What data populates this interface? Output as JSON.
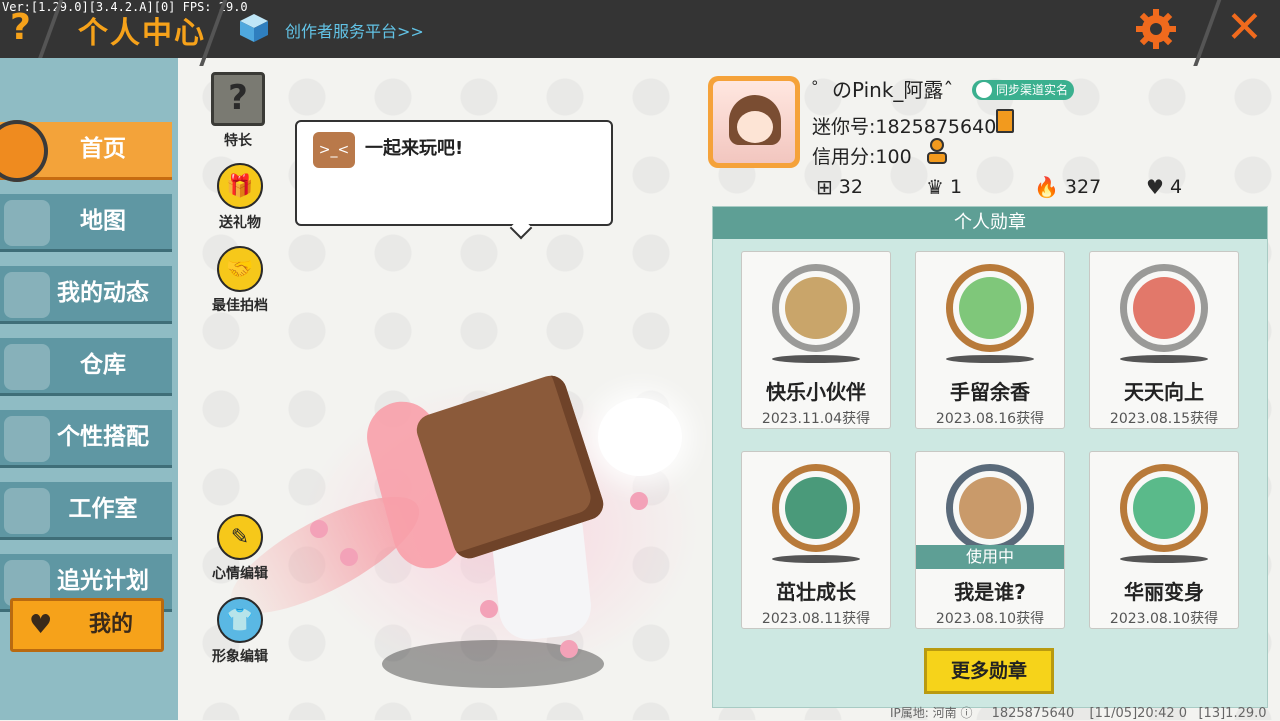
{
  "topbar": {
    "version_text": "Ver:[1.29.0][3.4.2.A][0] FPS: 29.0",
    "title": "个人中心",
    "creator_link": "创作者服务平台>>",
    "help_glyph": "?",
    "close_glyph": "✕"
  },
  "nav": {
    "items": [
      {
        "label": "首页",
        "icon": "home-icon",
        "active": true
      },
      {
        "label": "地图",
        "icon": "map-icon"
      },
      {
        "label": "我的动态",
        "icon": "bell-icon"
      },
      {
        "label": "仓库",
        "icon": "warehouse-icon"
      },
      {
        "label": "个性搭配",
        "icon": "outfit-icon"
      },
      {
        "label": "工作室",
        "icon": "studio-icon"
      },
      {
        "label": "追光计划",
        "icon": "light-plan-icon"
      }
    ],
    "my_button": "我的"
  },
  "actions": {
    "specialty": "特长",
    "gift": "送礼物",
    "best_partner": "最佳拍档",
    "mood_edit": "心情编辑",
    "avatar_edit": "形象编辑"
  },
  "bubble": {
    "text": "一起来玩吧!"
  },
  "profile": {
    "nickname": "゜のPink_阿露ˆ",
    "realname_tag": "同步渠道实名",
    "mini_id": "迷你号:1825875640",
    "credit": "信用分:100",
    "stats": {
      "likes": "32",
      "fans": "1",
      "popularity": "327",
      "hearts": "4"
    }
  },
  "medals": {
    "title": "个人勋章",
    "cards": [
      {
        "name": "快乐小伙伴",
        "date": "2023.11.04获得",
        "color": "#c9a56a"
      },
      {
        "name": "手留余香",
        "date": "2023.08.16获得",
        "color": "#7fc77a"
      },
      {
        "name": "天天向上",
        "date": "2023.08.15获得",
        "color": "#e2786a"
      },
      {
        "name": "茁壮成长",
        "date": "2023.08.11获得",
        "color": "#4a9a7a"
      },
      {
        "name": "我是谁?",
        "date": "2023.08.10获得",
        "color": "#c99a6a",
        "status": "使用中"
      },
      {
        "name": "华丽变身",
        "date": "2023.08.10获得",
        "color": "#5aba8a"
      }
    ],
    "more_button": "更多勋章"
  },
  "footer": {
    "ip_location": "IP属地: 河南",
    "uid": "1825875640",
    "timestamp": "[11/05]20:42 0",
    "build": "[13]1.29.0"
  },
  "colors": {
    "accent_orange": "#f6a21a",
    "nav_teal": "#5f97a3",
    "panel_header": "#5e9f95",
    "topbar": "#343434"
  }
}
